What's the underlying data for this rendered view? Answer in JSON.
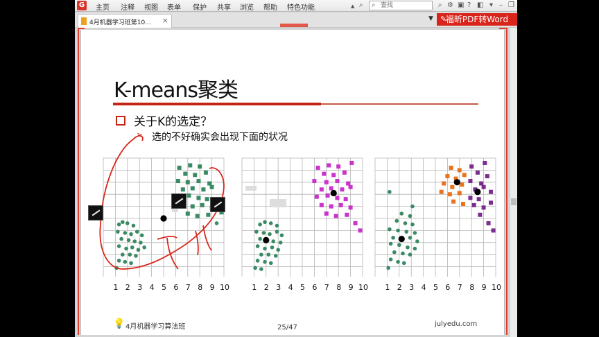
{
  "menu": {
    "items": [
      "主页",
      "注释",
      "视图",
      "表单",
      "保护",
      "共享",
      "浏览",
      "帮助",
      "特色功能"
    ]
  },
  "search": {
    "placeholder": "查找"
  },
  "tab": {
    "title": "4月机器学习班第10...",
    "close": "×"
  },
  "promo": {
    "label": "福昕PDF转Word"
  },
  "slide": {
    "title": "K-means聚类",
    "bullet": "关于K的选定？",
    "sub_bullet": "选的不好确实会出现下面的状况",
    "footer_text": "4月机器学习算法班",
    "page": "25/47",
    "site": "julyedu.com"
  },
  "chart_data": [
    {
      "type": "scatter",
      "x_ticks": [
        "1",
        "2",
        "3",
        "4",
        "5",
        "6",
        "7",
        "8",
        "9",
        "10"
      ],
      "series": [
        {
          "color": "#3a8a63",
          "points": [
            [
              1.3,
              4.5
            ],
            [
              1.6,
              4.7
            ],
            [
              2.0,
              4.6
            ],
            [
              2.5,
              4.4
            ],
            [
              1.2,
              3.9
            ],
            [
              1.8,
              3.8
            ],
            [
              2.3,
              3.7
            ],
            [
              2.8,
              3.9
            ],
            [
              3.2,
              3.6
            ],
            [
              1.5,
              3.3
            ],
            [
              2.1,
              3.2
            ],
            [
              2.6,
              3.1
            ],
            [
              3.1,
              3.0
            ],
            [
              1.3,
              2.7
            ],
            [
              1.9,
              2.5
            ],
            [
              2.4,
              2.6
            ],
            [
              2.9,
              2.4
            ],
            [
              3.4,
              2.6
            ],
            [
              1.6,
              2.0
            ],
            [
              2.2,
              2.0
            ],
            [
              2.7,
              1.9
            ],
            [
              1.3,
              1.5
            ],
            [
              1.8,
              1.4
            ],
            [
              2.3,
              1.3
            ],
            [
              1.1,
              0.9
            ],
            [
              6.3,
              9.2
            ],
            [
              7.2,
              9.4
            ],
            [
              8.0,
              9.3
            ],
            [
              6.8,
              8.7
            ],
            [
              7.6,
              8.6
            ],
            [
              8.5,
              8.8
            ],
            [
              6.2,
              8.1
            ],
            [
              7.0,
              8.0
            ],
            [
              7.9,
              8.1
            ],
            [
              8.8,
              7.9
            ],
            [
              6.6,
              7.4
            ],
            [
              7.4,
              7.5
            ],
            [
              8.3,
              7.4
            ],
            [
              9.0,
              7.6
            ],
            [
              6.2,
              6.8
            ],
            [
              7.1,
              6.9
            ],
            [
              7.9,
              6.7
            ],
            [
              8.6,
              6.6
            ],
            [
              6.6,
              6.1
            ],
            [
              7.4,
              6.0
            ],
            [
              8.2,
              6.1
            ],
            [
              9.0,
              5.9
            ],
            [
              7.0,
              5.4
            ],
            [
              7.8,
              5.2
            ],
            [
              8.7,
              5.3
            ],
            [
              9.4,
              4.6
            ],
            [
              9.8,
              5.5
            ]
          ]
        },
        {
          "color": "#000000",
          "points": [
            [
              5.0,
              5.0
            ]
          ]
        }
      ]
    },
    {
      "type": "scatter",
      "x_ticks": [
        "1",
        "2",
        "3",
        "4",
        "5",
        "6",
        "7",
        "8",
        "9",
        "10"
      ],
      "series": [
        {
          "color": "#3a8a63",
          "points": [
            [
              1.5,
              4.5
            ],
            [
              1.9,
              4.7
            ],
            [
              2.4,
              4.6
            ],
            [
              2.9,
              4.4
            ],
            [
              1.2,
              3.9
            ],
            [
              1.8,
              3.8
            ],
            [
              2.3,
              3.7
            ],
            [
              2.9,
              3.9
            ],
            [
              3.3,
              3.6
            ],
            [
              1.5,
              3.3
            ],
            [
              2.1,
              3.2
            ],
            [
              2.6,
              3.1
            ],
            [
              3.2,
              3.0
            ],
            [
              1.3,
              2.7
            ],
            [
              1.9,
              2.5
            ],
            [
              2.5,
              2.6
            ],
            [
              3.0,
              2.4
            ],
            [
              1.6,
              2.0
            ],
            [
              2.2,
              2.0
            ],
            [
              2.8,
              1.9
            ],
            [
              1.3,
              1.5
            ],
            [
              1.9,
              1.4
            ],
            [
              2.4,
              1.3
            ],
            [
              1.1,
              0.9
            ],
            [
              1.6,
              0.8
            ]
          ]
        },
        {
          "color": "#cc33cc",
          "points": [
            [
              6.3,
              9.2
            ],
            [
              7.2,
              9.4
            ],
            [
              8.0,
              9.3
            ],
            [
              9.1,
              9.6
            ],
            [
              6.8,
              8.7
            ],
            [
              7.6,
              8.6
            ],
            [
              8.5,
              8.8
            ],
            [
              6.0,
              8.1
            ],
            [
              7.0,
              8.0
            ],
            [
              7.9,
              8.1
            ],
            [
              8.8,
              7.9
            ],
            [
              6.6,
              7.4
            ],
            [
              7.4,
              7.5
            ],
            [
              8.3,
              7.4
            ],
            [
              9.0,
              7.6
            ],
            [
              6.2,
              6.8
            ],
            [
              7.1,
              6.9
            ],
            [
              7.9,
              6.7
            ],
            [
              8.6,
              6.6
            ],
            [
              6.6,
              6.1
            ],
            [
              7.4,
              6.0
            ],
            [
              8.2,
              6.1
            ],
            [
              9.0,
              5.9
            ],
            [
              7.0,
              5.4
            ],
            [
              7.8,
              5.2
            ],
            [
              8.7,
              5.3
            ],
            [
              9.4,
              4.6
            ],
            [
              9.8,
              4.0
            ]
          ]
        },
        {
          "color": "#000000",
          "points": [
            [
              2.0,
              3.2
            ],
            [
              7.6,
              7.1
            ]
          ]
        }
      ]
    },
    {
      "type": "scatter",
      "x_ticks": [
        "1",
        "2",
        "3",
        "4",
        "5",
        "6",
        "7",
        "8",
        "9",
        "10"
      ],
      "series": [
        {
          "color": "#3a8a63",
          "points": [
            [
              1.2,
              7.2
            ],
            [
              3.1,
              6.0
            ],
            [
              2.2,
              5.4
            ],
            [
              2.9,
              5.2
            ],
            [
              1.8,
              4.8
            ],
            [
              2.5,
              4.6
            ],
            [
              3.1,
              4.5
            ],
            [
              1.2,
              4.1
            ],
            [
              1.9,
              4.0
            ],
            [
              2.6,
              3.9
            ],
            [
              3.3,
              3.8
            ],
            [
              1.5,
              3.4
            ],
            [
              2.2,
              3.3
            ],
            [
              2.9,
              3.4
            ],
            [
              3.5,
              3.1
            ],
            [
              1.3,
              2.9
            ],
            [
              2.0,
              2.8
            ],
            [
              2.7,
              2.6
            ],
            [
              3.3,
              2.5
            ],
            [
              1.6,
              2.2
            ],
            [
              2.3,
              2.1
            ],
            [
              2.9,
              2.0
            ],
            [
              1.3,
              1.6
            ],
            [
              1.9,
              1.4
            ],
            [
              2.4,
              1.3
            ],
            [
              1.1,
              0.9
            ]
          ]
        },
        {
          "color": "#e8731c",
          "points": [
            [
              6.3,
              9.2
            ],
            [
              7.0,
              9.0
            ],
            [
              6.0,
              8.5
            ],
            [
              6.7,
              8.3
            ],
            [
              7.4,
              8.6
            ],
            [
              5.7,
              7.9
            ],
            [
              6.4,
              7.6
            ],
            [
              7.2,
              7.8
            ],
            [
              5.5,
              7.2
            ],
            [
              6.2,
              7.0
            ],
            [
              7.0,
              7.1
            ],
            [
              6.5,
              6.4
            ],
            [
              7.3,
              6.2
            ]
          ]
        },
        {
          "color": "#7b2d8e",
          "points": [
            [
              8.0,
              9.3
            ],
            [
              9.1,
              9.6
            ],
            [
              8.5,
              8.8
            ],
            [
              9.3,
              8.5
            ],
            [
              7.9,
              8.1
            ],
            [
              8.8,
              7.9
            ],
            [
              8.3,
              7.4
            ],
            [
              9.0,
              7.6
            ],
            [
              9.6,
              7.2
            ],
            [
              7.9,
              6.7
            ],
            [
              8.6,
              6.6
            ],
            [
              8.2,
              6.1
            ],
            [
              9.0,
              5.9
            ],
            [
              9.6,
              6.3
            ],
            [
              8.7,
              5.3
            ],
            [
              9.4,
              4.6
            ],
            [
              9.8,
              4.0
            ]
          ]
        },
        {
          "color": "#000000",
          "points": [
            [
              2.2,
              3.3
            ],
            [
              6.8,
              8.0
            ],
            [
              8.5,
              7.2
            ]
          ]
        }
      ]
    }
  ]
}
